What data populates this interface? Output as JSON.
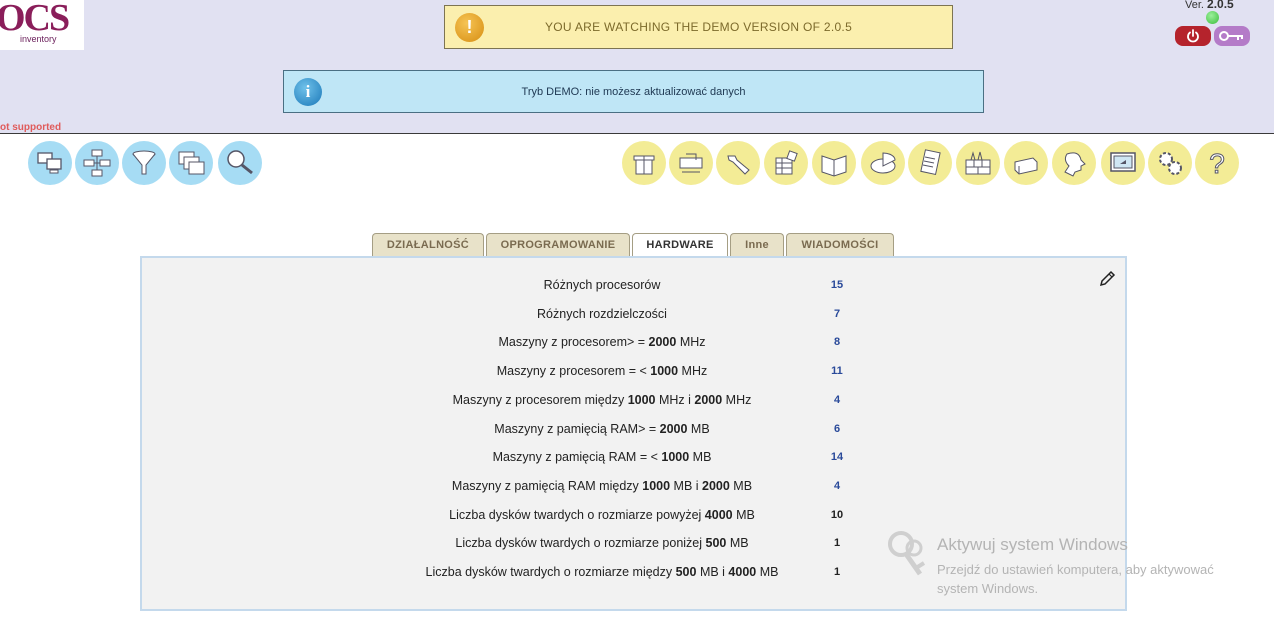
{
  "header": {
    "logo_text": "OCS",
    "logo_sub": "inventory",
    "not_supported": "ot supported",
    "warning": "YOU ARE WATCHING THE DEMO VERSION OF 2.0.5",
    "info": "Tryb DEMO: nie możesz aktualizować danych",
    "version_label": "Ver.",
    "version_number": "2.0.5"
  },
  "nav_left": [
    {
      "icon": "computers-icon"
    },
    {
      "icon": "network-icon"
    },
    {
      "icon": "filter-icon"
    },
    {
      "icon": "windows-icon"
    },
    {
      "icon": "search-icon"
    }
  ],
  "nav_right": [
    {
      "icon": "package-icon"
    },
    {
      "icon": "deploy-icon"
    },
    {
      "icon": "tools-icon"
    },
    {
      "icon": "inventory-icon"
    },
    {
      "icon": "book-icon"
    },
    {
      "icon": "dictionary-icon"
    },
    {
      "icon": "notes-icon"
    },
    {
      "icon": "firewall-icon"
    },
    {
      "icon": "server-icon"
    },
    {
      "icon": "user-icon"
    },
    {
      "icon": "display-icon"
    },
    {
      "icon": "settings-icon"
    },
    {
      "icon": "help-icon"
    }
  ],
  "tabs": [
    {
      "label": "DZIAŁALNOŚĆ"
    },
    {
      "label": "OPROGRAMOWANIE"
    },
    {
      "label": "HARDWARE",
      "active": true
    },
    {
      "label": "Inne"
    },
    {
      "label": "WIADOMOŚCI"
    }
  ],
  "stats": [
    {
      "pre": "Różnych procesorów",
      "value": "15"
    },
    {
      "pre": "Różnych rozdzielczości",
      "value": "7"
    },
    {
      "pre": "Maszyny z procesorem> = ",
      "b1": "2000",
      "mid": " MHz",
      "value": "8"
    },
    {
      "pre": "Maszyny z procesorem = < ",
      "b1": "1000",
      "mid": " MHz",
      "value": "11"
    },
    {
      "pre": "Maszyny z procesorem między ",
      "b1": "1000",
      "mid": " MHz i ",
      "b2": "2000",
      "post": " MHz",
      "value": "4"
    },
    {
      "pre": "Maszyny z pamięcią RAM> = ",
      "b1": "2000",
      "mid": " MB",
      "value": "6"
    },
    {
      "pre": "Maszyny z pamięcią RAM = < ",
      "b1": "1000",
      "mid": " MB",
      "value": "14"
    },
    {
      "pre": "Maszyny z pamięcią RAM między ",
      "b1": "1000",
      "mid": " MB i ",
      "b2": "2000",
      "post": " MB",
      "value": "4"
    },
    {
      "pre": "Liczba dysków twardych o rozmiarze powyżej ",
      "b1": "4000",
      "mid": " MB",
      "value": "10"
    },
    {
      "pre": "Liczba dysków twardych o rozmiarze poniżej ",
      "b1": "500",
      "mid": " MB",
      "value": "1"
    },
    {
      "pre": "Liczba dysków twardych o rozmiarze między ",
      "b1": "500",
      "mid": " MB i ",
      "b2": "4000",
      "post": " MB",
      "value": "1"
    }
  ],
  "watermark": {
    "title": "Aktywuj system Windows",
    "line1": "Przejdź do ustawień komputera, aby aktywować",
    "line2": "system Windows."
  },
  "colors": {
    "header_bg": "#e1e1f2",
    "warn_bg": "#fbefae",
    "info_bg": "#bfe6f6",
    "nav_blue": "#a6dcf4",
    "nav_yellow": "#f3ec96",
    "value_blue": "#2a4a9a"
  }
}
